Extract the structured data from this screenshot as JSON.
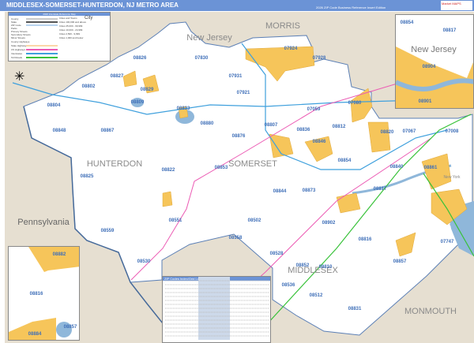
{
  "header": {
    "title": "MIDDLESEX-SOMERSET-HUNTERDON, NJ METRO AREA",
    "subtitle": "2026 ZIP Code Business Reference Insert Edition",
    "logo": "Market MAPS"
  },
  "regions": [
    "New Jersey",
    "MORRIS",
    "HUNTERDON",
    "SOMERSET",
    "Pennsylvania",
    "MIDDLESEX",
    "MONMOUTH",
    "New York"
  ],
  "zips": [
    "08826",
    "07830",
    "07924",
    "07928",
    "08827",
    "07931",
    "08802",
    "07921",
    "08829",
    "08804",
    "08833",
    "07059",
    "08809",
    "08848",
    "08867",
    "08880",
    "08807",
    "08836",
    "08812",
    "08820",
    "07067",
    "08876",
    "08846",
    "07008",
    "08822",
    "08853",
    "08854",
    "08825",
    "08844",
    "08873",
    "08861",
    "08817",
    "08551",
    "08502",
    "08902",
    "08816",
    "08559",
    "08558",
    "08528",
    "08530",
    "08852",
    "08810",
    "08857",
    "07747",
    "08512",
    "08536",
    "08831",
    "07080",
    "08840"
  ],
  "inset_top": {
    "state": "New Jersey",
    "zips": [
      "08854",
      "08817",
      "08904",
      "08901"
    ]
  },
  "inset_bottom": {
    "zips": [
      "08882",
      "08816",
      "08884",
      "08857"
    ]
  },
  "legend": {
    "title": "2026 Interstate Reference Map",
    "left": [
      "County",
      "State",
      "ZIP Code",
      "Parks",
      "Primary Streets",
      "Secondary Streets",
      "Minor Streets",
      "County Highways",
      "State Highways",
      "US Highways",
      "Interstates",
      "Toll Roads"
    ],
    "right": [
      "Cities and Towns",
      "Cities 100,000 and above",
      "Cities 25,000 - 99,999",
      "Cities 10,000 - 24,999",
      "Cities 2,500 - 9,999",
      "Cities 1,000 and below"
    ],
    "city": "City"
  },
  "index_table": {
    "title": "ZIP Codes Index/Grid Location"
  },
  "colors": {
    "header": "#6b93d6",
    "land": "#e6dfd1",
    "urban": "#f6c55a",
    "water": "#8fb7da",
    "zip_label": "#3f6fb8"
  }
}
